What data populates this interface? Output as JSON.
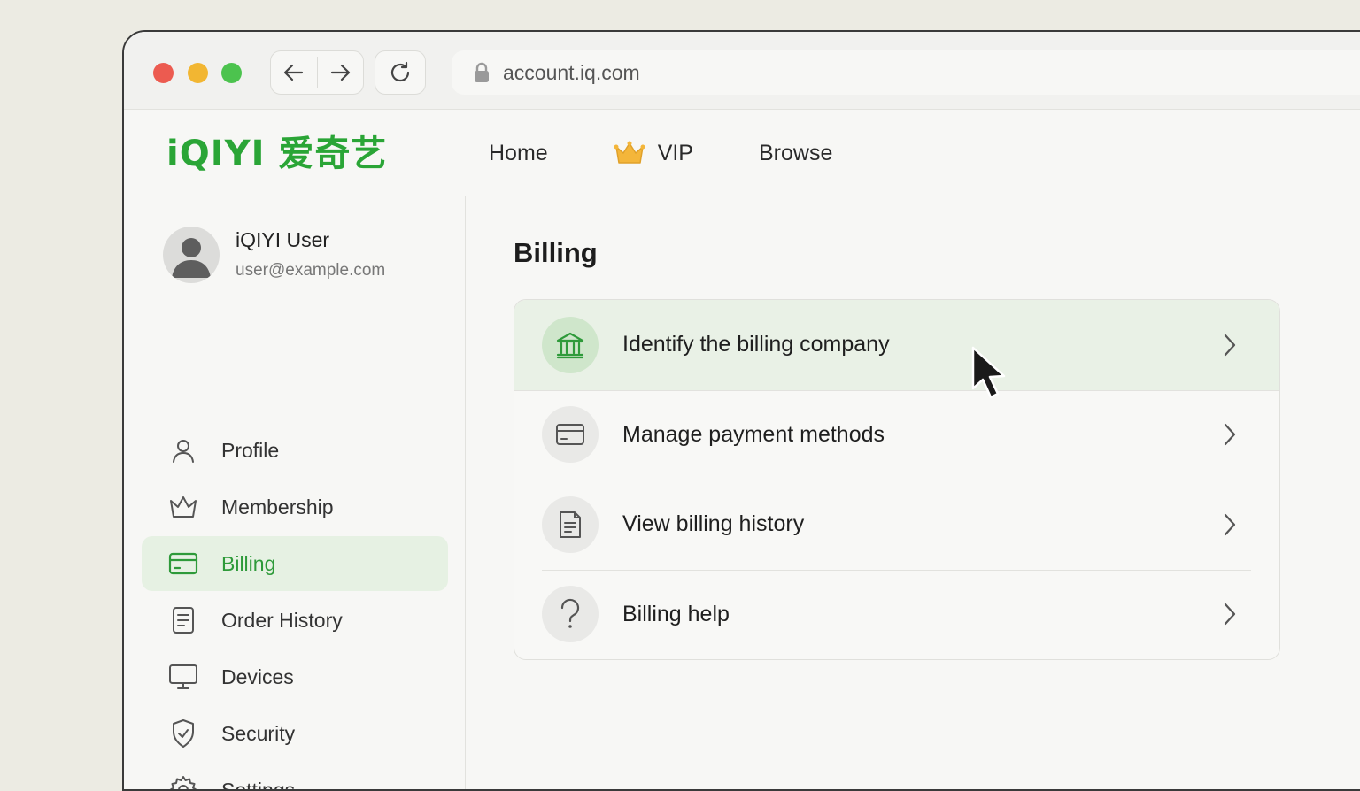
{
  "browser": {
    "url": "account.iq.com"
  },
  "site": {
    "logo_text": "iQIYI 爱奇艺",
    "brand_color": "#2aa536",
    "nav": [
      {
        "label": "Home"
      },
      {
        "label": "VIP",
        "icon": "crown-icon"
      },
      {
        "label": "Browse"
      }
    ]
  },
  "user": {
    "name": "iQIYI User",
    "email": "user@example.com"
  },
  "sidebar": {
    "items": [
      {
        "label": "Profile",
        "icon": "person-icon",
        "active": false
      },
      {
        "label": "Membership",
        "icon": "crown-outline-icon",
        "active": false
      },
      {
        "label": "Billing",
        "icon": "card-icon",
        "active": true
      },
      {
        "label": "Order History",
        "icon": "document-icon",
        "active": false
      },
      {
        "label": "Devices",
        "icon": "monitor-icon",
        "active": false
      },
      {
        "label": "Security",
        "icon": "shield-icon",
        "active": false
      },
      {
        "label": "Settings",
        "icon": "gear-icon",
        "active": false
      }
    ]
  },
  "main": {
    "title": "Billing",
    "options": [
      {
        "label": "Identify the billing company",
        "icon": "bank-icon",
        "highlighted": true
      },
      {
        "label": "Manage payment methods",
        "icon": "card-icon"
      },
      {
        "label": "View billing history",
        "icon": "receipt-icon"
      },
      {
        "label": "Billing help",
        "icon": "question-icon"
      }
    ]
  }
}
